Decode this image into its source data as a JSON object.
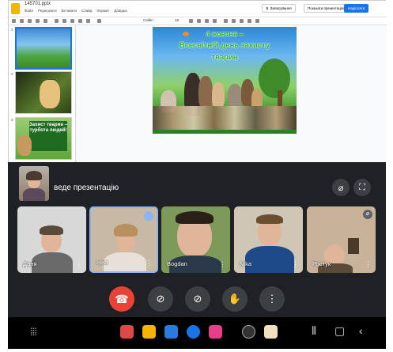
{
  "slides_app": {
    "file_name": "145701.pptx",
    "menu": [
      "Файл",
      "Редагувати",
      "Вставити",
      "Слайд",
      "Формат",
      "Довідка"
    ],
    "comments_button": "Записування",
    "present_button": "Показати презентацію",
    "share_button": "Надіслати",
    "font": "Calibri",
    "font_size": "18",
    "slide_numbers": [
      "1",
      "2",
      "3"
    ],
    "thumb3_text": "Захист тварин – турбота людей!",
    "slide_title_line1": "4 жовтня –",
    "slide_title_line2": "Всесвітній день захисту",
    "slide_title_line3": "тварин"
  },
  "meet": {
    "presenting_text": "веде презентацію",
    "participants": [
      {
        "name": "Даня"
      },
      {
        "name": "Інна"
      },
      {
        "name": "Bogdan"
      },
      {
        "name": "Nika"
      },
      {
        "name": "Ростук"
      }
    ],
    "controls": {
      "end_call": "☎",
      "camera": "⊘",
      "mic": "⊘",
      "raise_hand": "✋",
      "more": "⋮"
    }
  },
  "colors": {
    "accent": "#1a73e8",
    "end_call": "#ea4335",
    "meet_bg": "#202124",
    "title_green": "#2fb52f"
  },
  "icons": [
    "grid-icon",
    "recents-icon",
    "home-icon",
    "back-icon"
  ]
}
